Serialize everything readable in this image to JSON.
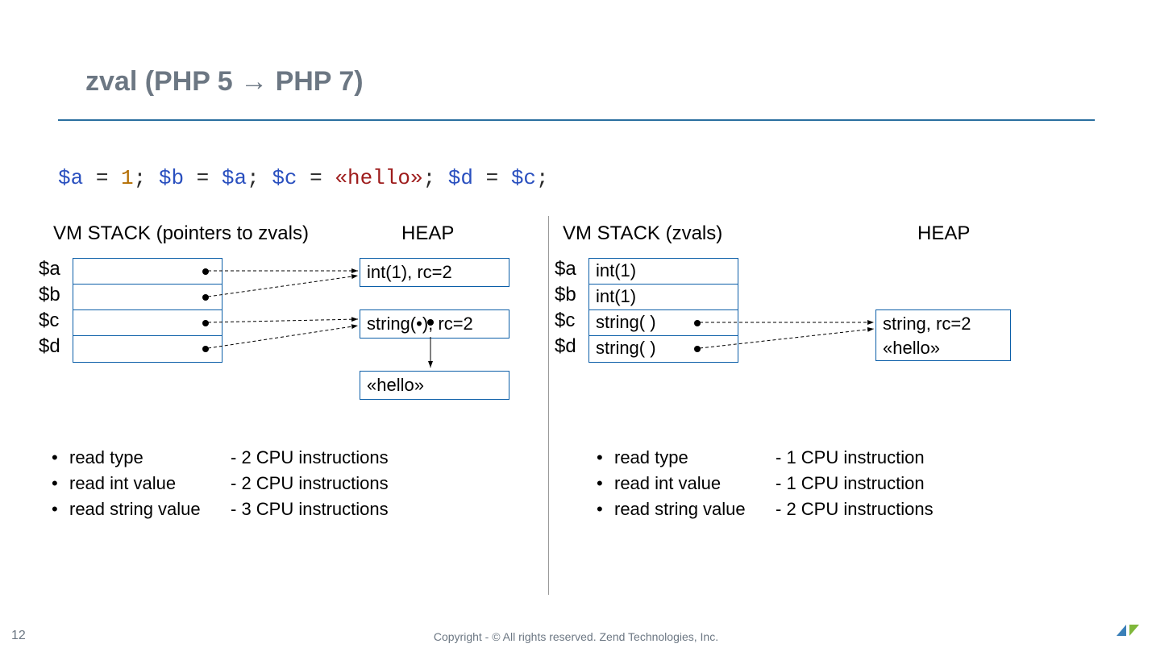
{
  "title": "zval (PHP 5 → PHP 7)",
  "code": {
    "tokens": [
      {
        "t": "$a",
        "c": "c-var"
      },
      {
        "t": " = ",
        "c": "c-eq"
      },
      {
        "t": "1",
        "c": "c-num"
      },
      {
        "t": "; ",
        "c": "c-semi"
      },
      {
        "t": "$b",
        "c": "c-var"
      },
      {
        "t": " = ",
        "c": "c-eq"
      },
      {
        "t": "$a",
        "c": "c-var"
      },
      {
        "t": "; ",
        "c": "c-semi"
      },
      {
        "t": "$c",
        "c": "c-var"
      },
      {
        "t": " = ",
        "c": "c-eq"
      },
      {
        "t": "«hello»",
        "c": "c-str"
      },
      {
        "t": "; ",
        "c": "c-semi"
      },
      {
        "t": "$d",
        "c": "c-var"
      },
      {
        "t": " = ",
        "c": "c-eq"
      },
      {
        "t": "$c",
        "c": "c-var"
      },
      {
        "t": ";",
        "c": "c-semi"
      }
    ]
  },
  "left": {
    "stack_heading": "VM STACK (pointers to zvals)",
    "heap_heading": "HEAP",
    "vars": [
      "$a",
      "$b",
      "$c",
      "$d"
    ],
    "heap_int": "int(1), rc=2",
    "heap_str": "string(•), rc=2",
    "heap_hello": "«hello»",
    "bullets": [
      {
        "label": "read type",
        "val": "- 2 CPU instructions"
      },
      {
        "label": "read int value",
        "val": "- 2 CPU instructions"
      },
      {
        "label": "read string value",
        "val": "- 3 CPU instructions"
      }
    ]
  },
  "right": {
    "stack_heading": "VM STACK (zvals)",
    "heap_heading": "HEAP",
    "vars": [
      "$a",
      "$b",
      "$c",
      "$d"
    ],
    "stack_vals": [
      "int(1)",
      "int(1)",
      "string(  )",
      "string(  )"
    ],
    "heap_line1": "string, rc=2",
    "heap_line2": "«hello»",
    "bullets": [
      {
        "label": "read type",
        "val": "- 1 CPU instruction"
      },
      {
        "label": "read int value",
        "val": "- 1 CPU instruction"
      },
      {
        "label": "read string value",
        "val": "- 2 CPU instructions"
      }
    ]
  },
  "page_number": "12",
  "footer": "Copyright - © All rights reserved. Zend Technologies, Inc."
}
